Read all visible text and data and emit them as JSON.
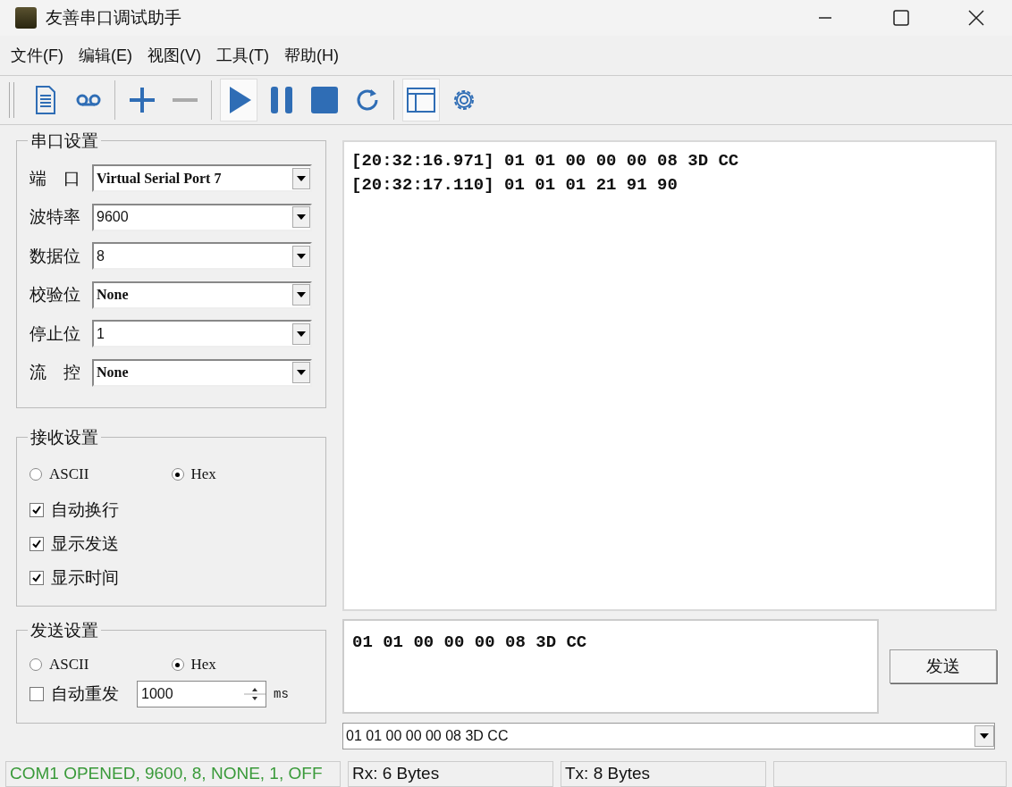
{
  "window": {
    "title": "友善串口调试助手"
  },
  "menu": [
    "文件(F)",
    "编辑(E)",
    "视图(V)",
    "工具(T)",
    "帮助(H)"
  ],
  "toolbar": [
    {
      "kind": "doc",
      "pressed": false
    },
    {
      "kind": "tape",
      "pressed": false
    },
    {
      "kind": "sep"
    },
    {
      "kind": "plus",
      "pressed": false
    },
    {
      "kind": "minus",
      "pressed": false
    },
    {
      "kind": "sep"
    },
    {
      "kind": "play",
      "pressed": true
    },
    {
      "kind": "pause",
      "pressed": false
    },
    {
      "kind": "stop",
      "pressed": false
    },
    {
      "kind": "refresh",
      "pressed": false
    },
    {
      "kind": "sep"
    },
    {
      "kind": "window",
      "pressed": true
    },
    {
      "kind": "gear",
      "pressed": false
    }
  ],
  "serial_settings": {
    "title": "串口设置",
    "fields": [
      {
        "label": "端　口",
        "value": "Virtual Serial Port 7"
      },
      {
        "label": "波特率",
        "value": "9600"
      },
      {
        "label": "数据位",
        "value": "8"
      },
      {
        "label": "校验位",
        "value": "None"
      },
      {
        "label": "停止位",
        "value": "1"
      },
      {
        "label": "流　控",
        "value": "None"
      }
    ]
  },
  "receive_settings": {
    "title": "接收设置",
    "modes": [
      {
        "label": "ASCII",
        "selected": false
      },
      {
        "label": "Hex",
        "selected": true
      }
    ],
    "options": [
      {
        "label": "自动换行",
        "checked": true
      },
      {
        "label": "显示发送",
        "checked": true
      },
      {
        "label": "显示时间",
        "checked": true
      }
    ]
  },
  "send_settings": {
    "title": "发送设置",
    "modes": [
      {
        "label": "ASCII",
        "selected": false
      },
      {
        "label": "Hex",
        "selected": true
      }
    ],
    "auto_resend": {
      "label": "自动重发",
      "checked": false,
      "interval": "1000",
      "unit": "ms"
    }
  },
  "receive_log": [
    "[20:32:16.971] 01 01 00 00 00 08 3D CC",
    "[20:32:17.110] 01 01 01 21 91 90"
  ],
  "send_text": "01 01 00 00 00 08 3D CC",
  "send_button": "发送",
  "history_value": "01 01 00 00 00 08 3D CC",
  "status_bar": [
    "COM1 OPENED, 9600, 8, NONE, 1, OFF",
    "Rx: 6 Bytes",
    "Tx: 8 Bytes"
  ]
}
